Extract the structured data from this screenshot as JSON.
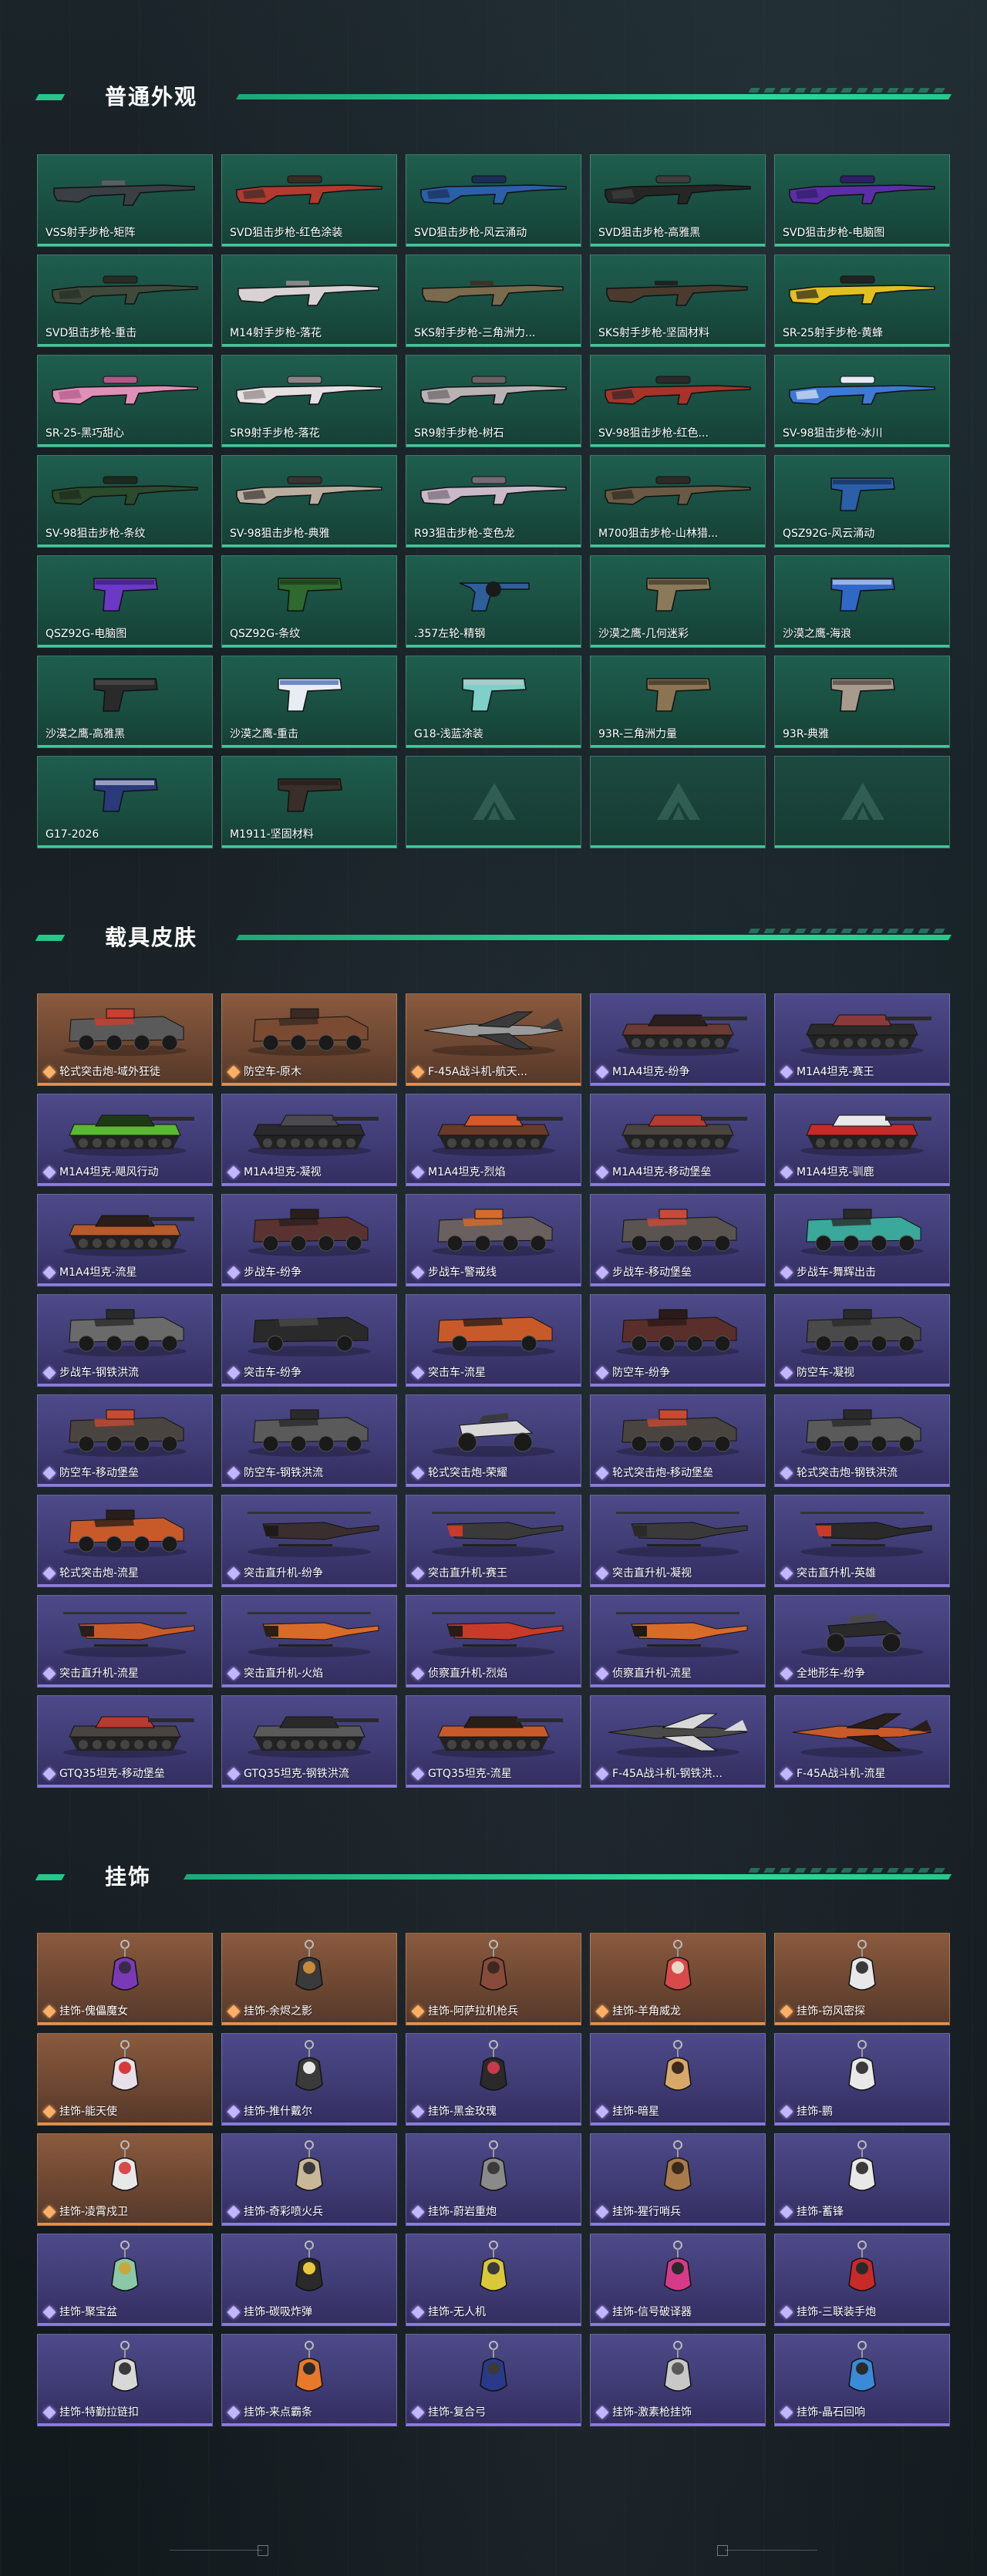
{
  "sections": [
    {
      "title": "普通外观",
      "type": "weapon",
      "items": [
        {
          "label": "VSS射手步枪-矩阵",
          "kind": "rifle",
          "colors": [
            "#3a3e45",
            "#5a5f66"
          ]
        },
        {
          "label": "SVD狙击步枪-红色涂装",
          "kind": "sniper",
          "colors": [
            "#b23a2e",
            "#3a2b26"
          ]
        },
        {
          "label": "SVD狙击步枪-风云涌动",
          "kind": "sniper",
          "colors": [
            "#2b5fa8",
            "#1b2e55"
          ]
        },
        {
          "label": "SVD狙击步枪-高雅黑",
          "kind": "sniper",
          "colors": [
            "#262626",
            "#3e3e3e"
          ]
        },
        {
          "label": "SVD狙击步枪-电脑图",
          "kind": "sniper",
          "colors": [
            "#5b2ea8",
            "#2e1e66"
          ]
        },
        {
          "label": "SVD狙击步枪-重击",
          "kind": "sniper",
          "colors": [
            "#3f4a3a",
            "#262d24"
          ]
        },
        {
          "label": "M14射手步枪-落花",
          "kind": "rifle",
          "colors": [
            "#d8d2d4",
            "#8a8486"
          ]
        },
        {
          "label": "SKS射手步枪-三角洲力...",
          "kind": "rifle",
          "colors": [
            "#7a6a4e",
            "#3b3328"
          ]
        },
        {
          "label": "SKS射手步枪-坚固材料",
          "kind": "rifle",
          "colors": [
            "#4a3b2e",
            "#222"
          ]
        },
        {
          "label": "SR-25射手步枪-黄蜂",
          "kind": "sniper",
          "colors": [
            "#e2c021",
            "#222"
          ]
        },
        {
          "label": "SR-25-黑巧甜心",
          "kind": "sniper",
          "colors": [
            "#e08fb8",
            "#b05a88"
          ]
        },
        {
          "label": "SR9射手步枪-落花",
          "kind": "sniper",
          "colors": [
            "#e6e0e2",
            "#8a8486"
          ]
        },
        {
          "label": "SR9射手步枪-树石",
          "kind": "sniper",
          "colors": [
            "#b8b2b4",
            "#6a6466"
          ]
        },
        {
          "label": "SV-98狙击步枪-红色...",
          "kind": "sniper",
          "colors": [
            "#a8332a",
            "#2a2a2a"
          ]
        },
        {
          "label": "SV-98狙击步枪-冰川",
          "kind": "sniper",
          "colors": [
            "#3d7ad8",
            "#e2eaf5"
          ]
        },
        {
          "label": "SV-98狙击步枪-条纹",
          "kind": "sniper",
          "colors": [
            "#2c4a2c",
            "#1d2a1d"
          ]
        },
        {
          "label": "SV-98狙击步枪-典雅",
          "kind": "sniper",
          "colors": [
            "#b9ada0",
            "#3a3430"
          ]
        },
        {
          "label": "R93狙击步枪-变色龙",
          "kind": "sniper",
          "colors": [
            "#c9b9c9",
            "#776a77"
          ]
        },
        {
          "label": "M700狙击步枪-山林猎...",
          "kind": "sniper",
          "colors": [
            "#6a5a44",
            "#2e2a24"
          ]
        },
        {
          "label": "QSZ92G-风云涌动",
          "kind": "pistol",
          "colors": [
            "#2b5fa8",
            "#13254a"
          ]
        },
        {
          "label": "QSZ92G-电脑图",
          "kind": "pistol",
          "colors": [
            "#6b38c8",
            "#2e1a66"
          ]
        },
        {
          "label": "QSZ92G-条纹",
          "kind": "pistol",
          "colors": [
            "#2e6a2e",
            "#1a2e1a"
          ]
        },
        {
          "label": ".357左轮-精钢",
          "kind": "revolver",
          "colors": [
            "#2f5f9a",
            "#1a1a1a"
          ]
        },
        {
          "label": "沙漠之鹰-几何迷彩",
          "kind": "pistol",
          "colors": [
            "#8a7a5a",
            "#2f2a22"
          ]
        },
        {
          "label": "沙漠之鹰-海浪",
          "kind": "pistol",
          "colors": [
            "#3068c8",
            "#dfe8f3"
          ]
        },
        {
          "label": "沙漠之鹰-高雅黑",
          "kind": "pistol",
          "colors": [
            "#2a2a2a",
            "#555"
          ]
        },
        {
          "label": "沙漠之鹰-重击",
          "kind": "pistol",
          "colors": [
            "#e8ecf3",
            "#2246a8"
          ]
        },
        {
          "label": "G18-浅蓝涂装",
          "kind": "pistol",
          "colors": [
            "#7ed0c8",
            "#c8c8c8"
          ]
        },
        {
          "label": "93R-三角洲力量",
          "kind": "pistol",
          "colors": [
            "#8a7452",
            "#2a2520"
          ]
        },
        {
          "label": "93R-典雅",
          "kind": "pistol",
          "colors": [
            "#a89b8e",
            "#3a332c"
          ]
        },
        {
          "label": "G17-2026",
          "kind": "pistol",
          "colors": [
            "#2a3a7a",
            "#dfe4f0"
          ]
        },
        {
          "label": "M1911-坚固材料",
          "kind": "pistol",
          "colors": [
            "#3a2e28",
            "#1e1a18"
          ]
        },
        {
          "label": "",
          "kind": "empty",
          "colors": [
            "#fff",
            "#fff"
          ]
        },
        {
          "label": "",
          "kind": "empty",
          "colors": [
            "#fff",
            "#fff"
          ]
        },
        {
          "label": "",
          "kind": "empty",
          "colors": [
            "#fff",
            "#fff"
          ]
        }
      ]
    },
    {
      "title": "载具皮肤",
      "type": "vehicle",
      "items": [
        {
          "label": "轮式突击炮-域外狂徒",
          "kind": "apc",
          "rarity": "orange",
          "colors": [
            "#5a5a5a",
            "#c84030"
          ]
        },
        {
          "label": "防空车-原木",
          "kind": "apc",
          "rarity": "orange",
          "colors": [
            "#7a4a32",
            "#3a2a22"
          ]
        },
        {
          "label": "F-45A战斗机-航天...",
          "kind": "jet",
          "rarity": "orange",
          "colors": [
            "#9a9a9a",
            "#3a3a3a"
          ]
        },
        {
          "label": "M1A4坦克-纷争",
          "kind": "tank",
          "rarity": "purple",
          "colors": [
            "#6a3a34",
            "#2a1e1e"
          ]
        },
        {
          "label": "M1A4坦克-赛王",
          "kind": "tank",
          "rarity": "purple",
          "colors": [
            "#2a2a2a",
            "#8a3a3a"
          ]
        },
        {
          "label": "M1A4坦克-飓风行动",
          "kind": "tank",
          "rarity": "purple",
          "colors": [
            "#5ab832",
            "#1e3a12"
          ]
        },
        {
          "label": "M1A4坦克-凝视",
          "kind": "tank",
          "rarity": "purple",
          "colors": [
            "#2a2a2e",
            "#4a4a50"
          ]
        },
        {
          "label": "M1A4坦克-烈焰",
          "kind": "tank",
          "rarity": "purple",
          "colors": [
            "#6a3a2a",
            "#d8582a"
          ]
        },
        {
          "label": "M1A4坦克-移动堡垒",
          "kind": "tank",
          "rarity": "purple",
          "colors": [
            "#4a4440",
            "#b83a30"
          ]
        },
        {
          "label": "M1A4坦克-驯鹿",
          "kind": "tank",
          "rarity": "purple",
          "colors": [
            "#c82a2a",
            "#e8e8e8"
          ]
        },
        {
          "label": "M1A4坦克-流星",
          "kind": "tank",
          "rarity": "purple",
          "colors": [
            "#b85a2a",
            "#2a1e18"
          ]
        },
        {
          "label": "步战车-纷争",
          "kind": "apc",
          "rarity": "purple",
          "colors": [
            "#5a3230",
            "#2a1e1e"
          ]
        },
        {
          "label": "步战车-警戒线",
          "kind": "apc",
          "rarity": "purple",
          "colors": [
            "#6a6060",
            "#d86a2a"
          ]
        },
        {
          "label": "步战车-移动堡垒",
          "kind": "apc",
          "rarity": "purple",
          "colors": [
            "#5a5450",
            "#c84a3a"
          ]
        },
        {
          "label": "步战车-舞辉出击",
          "kind": "apc",
          "rarity": "purple",
          "colors": [
            "#3aa89a",
            "#2a2a2a"
          ]
        },
        {
          "label": "步战车-钢铁洪流",
          "kind": "apc",
          "rarity": "purple",
          "colors": [
            "#6a6a6a",
            "#2a2a2a"
          ]
        },
        {
          "label": "突击车-纷争",
          "kind": "truck",
          "rarity": "purple",
          "colors": [
            "#2a2a2a",
            "#4a4a4a"
          ]
        },
        {
          "label": "突击车-流星",
          "kind": "truck",
          "rarity": "purple",
          "colors": [
            "#c85a2a",
            "#2a1e18"
          ]
        },
        {
          "label": "防空车-纷争",
          "kind": "apc",
          "rarity": "purple",
          "colors": [
            "#5a2e2a",
            "#2a1a18"
          ]
        },
        {
          "label": "防空车-凝视",
          "kind": "apc",
          "rarity": "purple",
          "colors": [
            "#4a4a4a",
            "#2a2a2a"
          ]
        },
        {
          "label": "防空车-移动堡垒",
          "kind": "apc",
          "rarity": "purple",
          "colors": [
            "#4a4440",
            "#c84a30"
          ]
        },
        {
          "label": "防空车-钢铁洪流",
          "kind": "apc",
          "rarity": "purple",
          "colors": [
            "#5a5a5a",
            "#2a2a2a"
          ]
        },
        {
          "label": "轮式突击炮-荣耀",
          "kind": "buggy",
          "rarity": "purple",
          "colors": [
            "#d8d8d8",
            "#3a3a3a"
          ]
        },
        {
          "label": "轮式突击炮-移动堡垒",
          "kind": "apc",
          "rarity": "purple",
          "colors": [
            "#4a4440",
            "#c84a30"
          ]
        },
        {
          "label": "轮式突击炮-钢铁洪流",
          "kind": "apc",
          "rarity": "purple",
          "colors": [
            "#5a5a5a",
            "#2a2a2a"
          ]
        },
        {
          "label": "轮式突击炮-流星",
          "kind": "apc",
          "rarity": "purple",
          "colors": [
            "#c85a2a",
            "#2a1e18"
          ]
        },
        {
          "label": "突击直升机-纷争",
          "kind": "heli",
          "rarity": "purple",
          "colors": [
            "#3a2e2e",
            "#1e1a1a"
          ]
        },
        {
          "label": "突击直升机-赛王",
          "kind": "heli",
          "rarity": "purple",
          "colors": [
            "#3a3a3a",
            "#c83a2a"
          ]
        },
        {
          "label": "突击直升机-凝视",
          "kind": "heli",
          "rarity": "purple",
          "colors": [
            "#3a3a3a",
            "#2a2a2a"
          ]
        },
        {
          "label": "突击直升机-英雄",
          "kind": "heli",
          "rarity": "purple",
          "colors": [
            "#2a2a2a",
            "#c83a2a"
          ]
        },
        {
          "label": "突击直升机-流星",
          "kind": "heli",
          "rarity": "purple",
          "colors": [
            "#c85a2a",
            "#2a1e18"
          ]
        },
        {
          "label": "突击直升机-火焰",
          "kind": "heli",
          "rarity": "purple",
          "colors": [
            "#d86a2a",
            "#2a1e18"
          ]
        },
        {
          "label": "侦察直升机-烈焰",
          "kind": "heli",
          "rarity": "purple",
          "colors": [
            "#c83a2a",
            "#2a1a18"
          ]
        },
        {
          "label": "侦察直升机-流星",
          "kind": "heli",
          "rarity": "purple",
          "colors": [
            "#d86a2a",
            "#1e1a18"
          ]
        },
        {
          "label": "全地形车-纷争",
          "kind": "atv",
          "rarity": "purple",
          "colors": [
            "#2a2a2a",
            "#4a4a4a"
          ]
        },
        {
          "label": "GTQ35坦克-移动堡垒",
          "kind": "tank",
          "rarity": "purple",
          "colors": [
            "#4a4440",
            "#b83a30"
          ]
        },
        {
          "label": "GTQ35坦克-钢铁洪流",
          "kind": "tank",
          "rarity": "purple",
          "colors": [
            "#5a5a5a",
            "#2a2a2a"
          ]
        },
        {
          "label": "GTQ35坦克-流星",
          "kind": "tank",
          "rarity": "purple",
          "colors": [
            "#c85a2a",
            "#2a1e18"
          ]
        },
        {
          "label": "F-45A战斗机-钢铁洪...",
          "kind": "jet",
          "rarity": "purple",
          "colors": [
            "#4a4a4a",
            "#d8d8d8"
          ]
        },
        {
          "label": "F-45A战斗机-流星",
          "kind": "jet",
          "rarity": "purple",
          "colors": [
            "#c85a2a",
            "#2a1e18"
          ]
        }
      ]
    },
    {
      "title": "挂饰",
      "type": "charm",
      "items": [
        {
          "label": "挂饰-傀儡魔女",
          "rarity": "orange",
          "colors": [
            "#7a3ab8",
            "#3a2a4a"
          ]
        },
        {
          "label": "挂饰-余烬之影",
          "rarity": "orange",
          "colors": [
            "#3a3a3a",
            "#c88a3a"
          ]
        },
        {
          "label": "挂饰-阿萨拉机枪兵",
          "rarity": "orange",
          "colors": [
            "#8a4a3a",
            "#3a2a22"
          ]
        },
        {
          "label": "挂饰-羊角威龙",
          "rarity": "orange",
          "colors": [
            "#d84a4a",
            "#e8d8c8"
          ]
        },
        {
          "label": "挂饰-窃风密探",
          "rarity": "orange",
          "colors": [
            "#e8e8e8",
            "#3a3a3a"
          ]
        },
        {
          "label": "挂饰-能天使",
          "rarity": "orange",
          "colors": [
            "#e8e0e8",
            "#d83a3a"
          ]
        },
        {
          "label": "挂饰-推什戴尔",
          "rarity": "purple",
          "colors": [
            "#3a3a3a",
            "#e8e8e8"
          ]
        },
        {
          "label": "挂饰-黑金玫瑰",
          "rarity": "purple",
          "colors": [
            "#2a2a2a",
            "#c83a4a"
          ]
        },
        {
          "label": "挂饰-暗星",
          "rarity": "purple",
          "colors": [
            "#d8a86a",
            "#3a2a22"
          ]
        },
        {
          "label": "挂饰-鹏",
          "rarity": "purple",
          "colors": [
            "#e8e8e8",
            "#3a3a3a"
          ]
        },
        {
          "label": "挂饰-凌霄戍卫",
          "rarity": "orange",
          "colors": [
            "#e8e8e8",
            "#d84a4a"
          ]
        },
        {
          "label": "挂饰-奇彩喷火兵",
          "rarity": "purple",
          "colors": [
            "#c8b898",
            "#3a3a3a"
          ]
        },
        {
          "label": "挂饰-蔚岩重炮",
          "rarity": "purple",
          "colors": [
            "#8a8a8a",
            "#3a3a3a"
          ]
        },
        {
          "label": "挂饰-猩行哨兵",
          "rarity": "purple",
          "colors": [
            "#a87a4a",
            "#3a2a1a"
          ]
        },
        {
          "label": "挂饰-蓄锋",
          "rarity": "purple",
          "colors": [
            "#e8e8e8",
            "#3a3a3a"
          ]
        },
        {
          "label": "挂饰-聚宝盆",
          "rarity": "purple",
          "colors": [
            "#8ac8a8",
            "#c8a83a"
          ]
        },
        {
          "label": "挂饰-碳吸炸弹",
          "rarity": "purple",
          "colors": [
            "#2a2a2a",
            "#e8c83a"
          ]
        },
        {
          "label": "挂饰-无人机",
          "rarity": "purple",
          "colors": [
            "#d8c83a",
            "#3a3a3a"
          ]
        },
        {
          "label": "挂饰-信号破译器",
          "rarity": "purple",
          "colors": [
            "#d83a8a",
            "#2a2a2a"
          ]
        },
        {
          "label": "挂饰-三联装手炮",
          "rarity": "purple",
          "colors": [
            "#c82a2a",
            "#2a2a2a"
          ]
        },
        {
          "label": "挂饰-特勤拉链扣",
          "rarity": "purple",
          "colors": [
            "#d8d8d8",
            "#3a3a3a"
          ]
        },
        {
          "label": "挂饰-来点霸条",
          "rarity": "purple",
          "colors": [
            "#e8782a",
            "#2a2a2a"
          ]
        },
        {
          "label": "挂饰-复合弓",
          "rarity": "purple",
          "colors": [
            "#2a3a8a",
            "#3a3a3a"
          ]
        },
        {
          "label": "挂饰-激素枪挂饰",
          "rarity": "purple",
          "colors": [
            "#c8c8c8",
            "#5a5a5a"
          ]
        },
        {
          "label": "挂饰-晶石回响",
          "rarity": "purple",
          "colors": [
            "#3a8ad8",
            "#2a2a2a"
          ]
        }
      ]
    }
  ]
}
